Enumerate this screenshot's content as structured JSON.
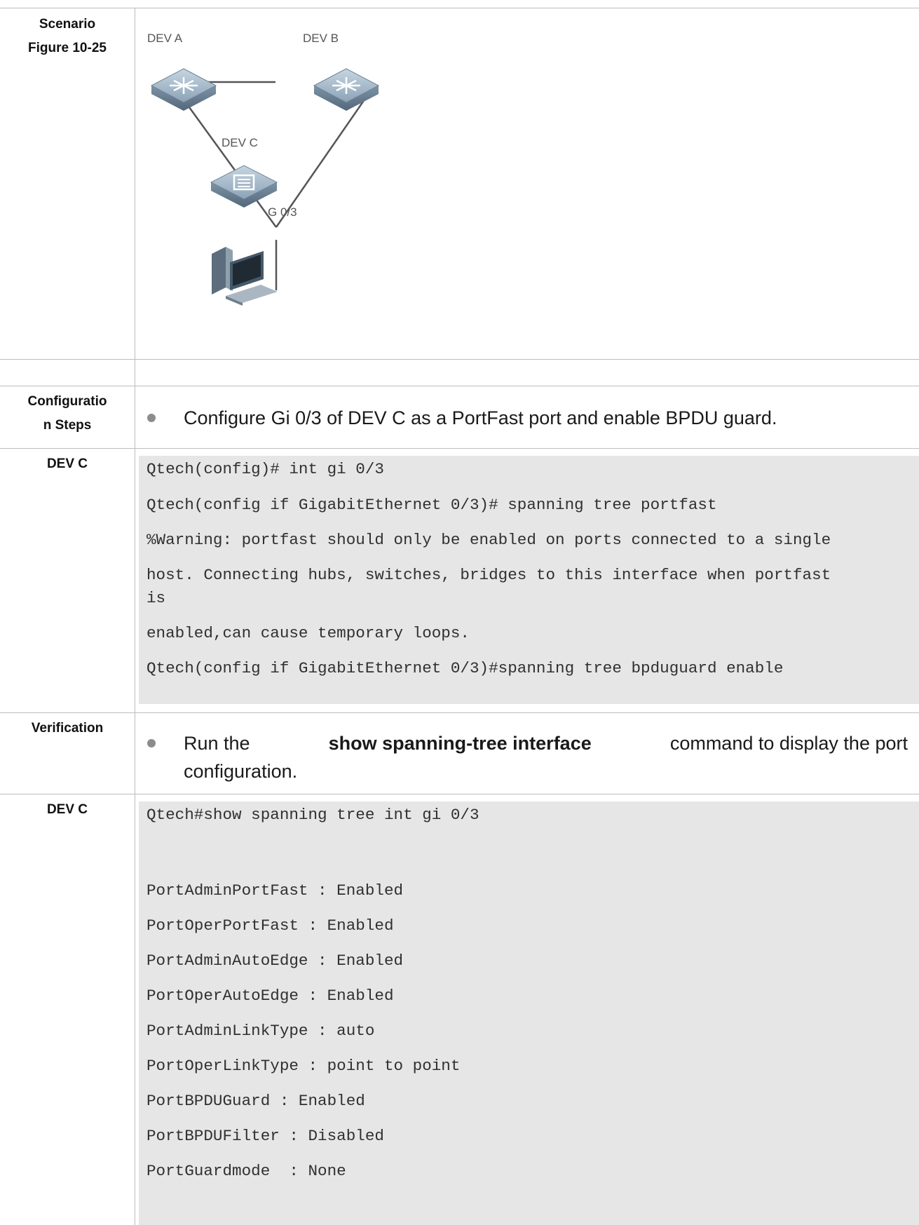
{
  "rows": {
    "scenario": {
      "label_1": "Scenario",
      "label_2": "Figure 10-25"
    },
    "config_steps": {
      "label_1": "Configuratio",
      "label_2": "n Steps",
      "bullet": "Configure Gi 0/3 of DEV C as a PortFast port and enable BPDU guard."
    },
    "config_code": {
      "label": "DEV C",
      "lines": [
        "Qtech(config)# int gi 0/3",
        "Qtech(config if GigabitEthernet 0/3)# spanning tree portfast",
        "%Warning: portfast should only be enabled on ports connected to a single",
        "host. Connecting hubs, switches, bridges to this interface when portfast",
        "is",
        "enabled,can cause temporary loops.",
        "Qtech(config if GigabitEthernet 0/3)#spanning tree bpduguard enable"
      ]
    },
    "verification": {
      "label": "Verification",
      "text_pre": "Run the",
      "cmd": "show spanning-tree interface",
      "text_post": "command to display the port",
      "line2": "configuration."
    },
    "verify_code": {
      "label": "DEV C",
      "lines": [
        "Qtech#show spanning tree int gi 0/3",
        "",
        "PortAdminPortFast : Enabled",
        "PortOperPortFast : Enabled",
        "PortAdminAutoEdge : Enabled",
        "PortOperAutoEdge : Enabled",
        "PortAdminLinkType : auto",
        "PortOperLinkType : point to point",
        "PortBPDUGuard : Enabled",
        "PortBPDUFilter : Disabled",
        "PortGuardmode  : None"
      ]
    }
  },
  "diagram": {
    "dev_a": "DEV A",
    "dev_b": "DEV B",
    "dev_c": "DEV C",
    "port": "G 0/3",
    "router_icon": "router-icon",
    "switch_icon": "switch-icon",
    "pc_icon": "computer-icon"
  }
}
